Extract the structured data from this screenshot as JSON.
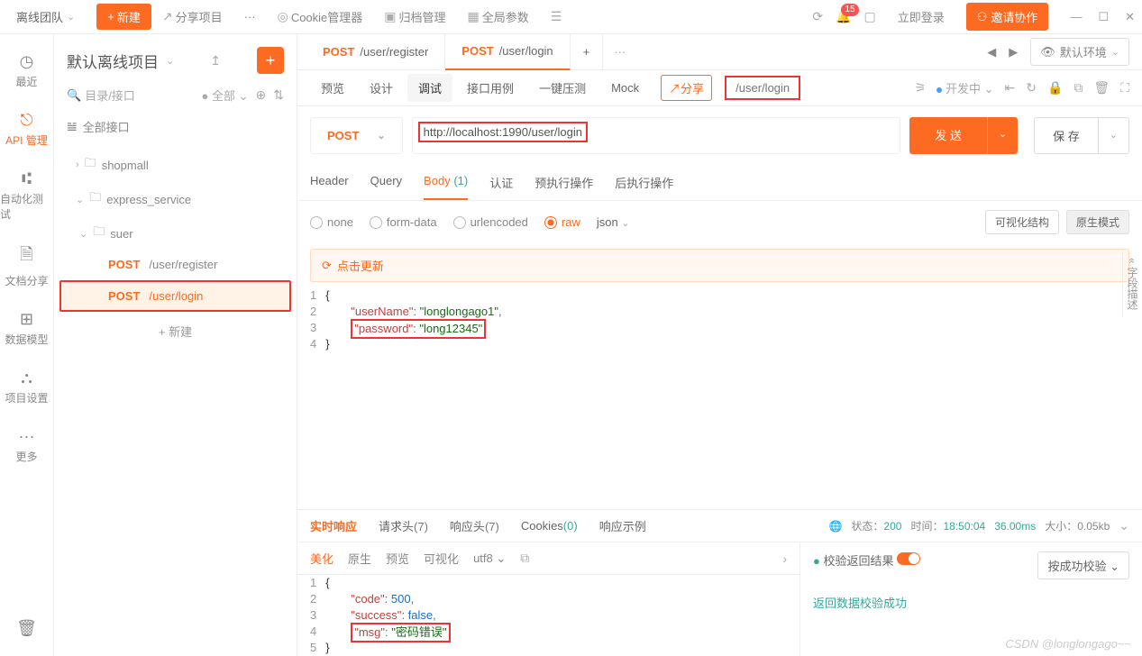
{
  "top": {
    "team": "离线团队",
    "new": "新建",
    "share": "分享项目",
    "cookie": "Cookie管理器",
    "archive": "归档管理",
    "global": "全局参数",
    "badge": "15",
    "login": "立即登录",
    "invite": "邀请协作"
  },
  "leftNav": {
    "recent": "最近",
    "api": "API 管理",
    "autotest": "自动化测试",
    "docshare": "文档分享",
    "datamodel": "数据模型",
    "projset": "项目设置",
    "more": "更多"
  },
  "side": {
    "project": "默认离线项目",
    "search": "目录/接口",
    "scope": "全部",
    "allApi": "全部接口",
    "tree": {
      "shopmall": "shopmall",
      "express": "express_service",
      "suer": "suer",
      "register": {
        "method": "POST",
        "path": "/user/register"
      },
      "login": {
        "method": "POST",
        "path": "/user/login"
      }
    },
    "addNew": "新建"
  },
  "tabs": {
    "t1": {
      "method": "POST",
      "path": "/user/register"
    },
    "t2": {
      "method": "POST",
      "path": "/user/login"
    },
    "env": "默认环境"
  },
  "subtabs": {
    "preview": "预览",
    "design": "设计",
    "debug": "调试",
    "usecase": "接口用例",
    "load": "一键压测",
    "mock": "Mock",
    "share": "分享",
    "urlPill": "/user/login",
    "devStatus": "开发中"
  },
  "urlBar": {
    "method": "POST",
    "url": "http://localhost:1990/user/login",
    "send": "发 送",
    "save": "保 存"
  },
  "reqTabs": {
    "header": "Header",
    "query": "Query",
    "body": "Body",
    "bodyCnt": "(1)",
    "auth": "认证",
    "prescript": "预执行操作",
    "postscript": "后执行操作"
  },
  "bodyType": {
    "none": "none",
    "formdata": "form-data",
    "urlencoded": "urlencoded",
    "raw": "raw",
    "json": "json",
    "viz": "可视化结构",
    "rawmode": "原生模式"
  },
  "refresh": "点击更新",
  "reqBody": {
    "l1": "{",
    "l2a": "\"userName\"",
    "l2b": ": ",
    "l2c": "\"longlongago1\"",
    "l2d": ",",
    "l3a": "\"password\"",
    "l3b": ": ",
    "l3c": "\"long12345\"",
    "l4": "}"
  },
  "sidePanel": "« 字段描述",
  "respTabs": {
    "realtime": "实时响应",
    "reqhead": "请求头",
    "reqheadCnt": "(7)",
    "resphead": "响应头",
    "respheadCnt": "(7)",
    "cookies": "Cookies",
    "cookiesCnt": "(0)",
    "example": "响应示例"
  },
  "respStatus": {
    "stateL": "状态：",
    "state": "200",
    "timeL": "时间：",
    "time": "18:50:04",
    "dur": "36.00ms",
    "sizeL": "大小：",
    "size": "0.05kb"
  },
  "respToolbar": {
    "beautify": "美化",
    "raw": "原生",
    "preview": "预览",
    "viz": "可视化",
    "enc": "utf8"
  },
  "respBody": {
    "l1": "{",
    "l2a": "\"code\"",
    "l2b": ": ",
    "l2c": "500",
    "l2d": ",",
    "l3a": "\"success\"",
    "l3b": ": ",
    "l3c": "false",
    "l3d": ",",
    "l4a": "\"msg\"",
    "l4b": ": ",
    "l4c": "\"密码错误\"",
    "l5": "}"
  },
  "validation": {
    "toggleLabel": "校验返回结果",
    "dropdown": "按成功校验",
    "success": "返回数据校验成功"
  },
  "watermark": "CSDN @longlongago~~"
}
